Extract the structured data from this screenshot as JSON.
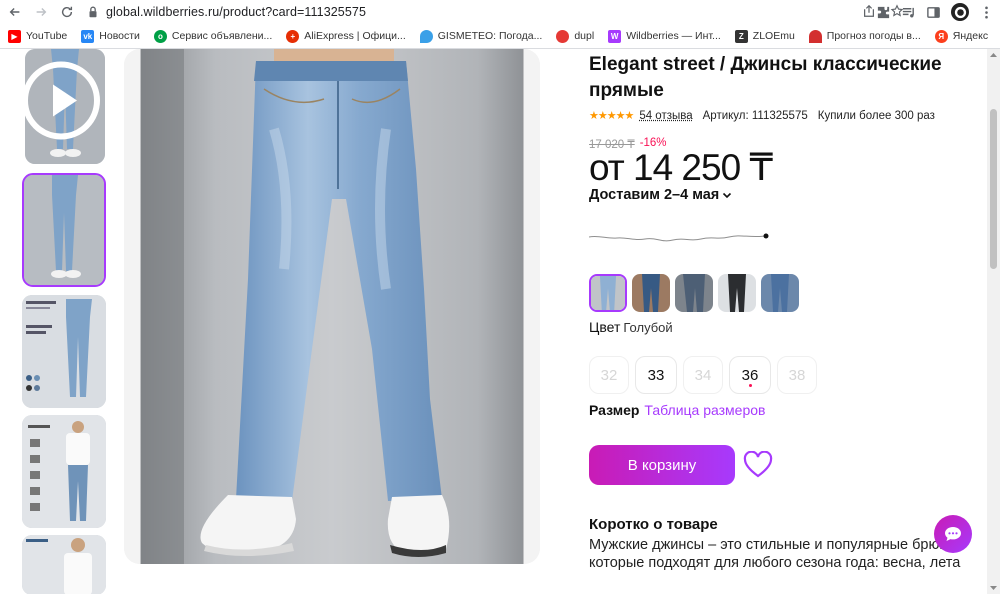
{
  "browser": {
    "url": "global.wildberries.ru/product?card=111325575",
    "bookmarks": [
      {
        "label": "YouTube",
        "color": "#ff0000",
        "icon": "youtube-icon"
      },
      {
        "label": "Новости",
        "color": "#2787f5",
        "icon": "vk-icon"
      },
      {
        "label": "Сервис объявлени...",
        "color": "#00a046",
        "icon": "ok-icon"
      },
      {
        "label": "AliExpress | Офици...",
        "color": "#e62e04",
        "icon": "aliexpress-icon"
      },
      {
        "label": "GISMETEO: Погода...",
        "color": "#3aa0e8",
        "icon": "gismeteo-icon"
      },
      {
        "label": "dupl",
        "color": "#e53935",
        "icon": "dupl-icon"
      },
      {
        "label": "Wildberries — Инт...",
        "color": "#a73afd",
        "icon": "wildberries-icon"
      },
      {
        "label": "ZLOEmu",
        "color": "#333333",
        "icon": "zloemu-icon"
      },
      {
        "label": "Прогноз погоды в...",
        "color": "#d32f2f",
        "icon": "umbrella-icon"
      },
      {
        "label": "Яндекс",
        "color": "#fc3f1d",
        "icon": "yandex-icon"
      }
    ]
  },
  "product": {
    "title": "Elegant street / Джинсы классические прямые",
    "stars": "★★★★★",
    "reviews": "54 отзыва",
    "article": "Артикул: 111325575",
    "bought": "Купили более 300 раз",
    "old_price": "17 020 ₸",
    "discount": "-16%",
    "price": "от 14 250 ₸",
    "delivery": "Доставим 2–4 мая",
    "color_key": "Цвет",
    "color_value": "Голубой",
    "sizes": [
      {
        "label": "32",
        "available": false
      },
      {
        "label": "33",
        "available": true
      },
      {
        "label": "34",
        "available": false
      },
      {
        "label": "36",
        "available": true
      },
      {
        "label": "38",
        "available": false
      }
    ],
    "size_key": "Размер",
    "size_table_link": "Таблица размеров",
    "cart_button": "В корзину",
    "about_title": "Коротко о товаре",
    "about_text": "Мужские джинсы – это стильные и популярные брюки, которые подходят для любого сезона года: весна, лета"
  },
  "colors": {
    "accent": "#a73afd",
    "accent2": "#c91bb5",
    "discount": "#f91155",
    "stars": "#ff9800"
  }
}
